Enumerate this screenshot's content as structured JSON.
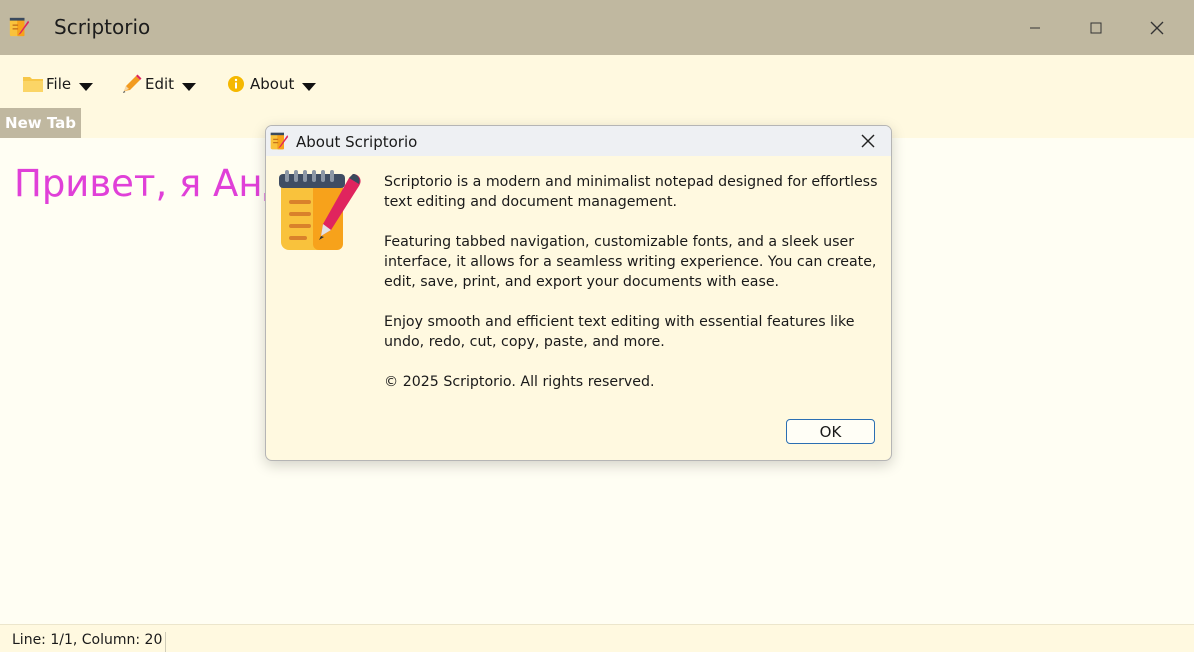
{
  "window": {
    "title": "Scriptorio",
    "controls": {
      "minimize": "minimize-icon",
      "maximize": "maximize-icon",
      "close": "close-icon"
    }
  },
  "menubar": {
    "items": [
      {
        "label": "File",
        "icon": "folder-icon"
      },
      {
        "label": "Edit",
        "icon": "pencil-icon"
      },
      {
        "label": "About",
        "icon": "info-icon"
      }
    ]
  },
  "tabs": [
    {
      "label": "New Tab",
      "active": true
    }
  ],
  "editor": {
    "content": "Привет, я Анд"
  },
  "statusbar": {
    "position": "Line: 1/1, Column: 20"
  },
  "dialog": {
    "title": "About Scriptorio",
    "paragraphs": [
      "Scriptorio is a modern and minimalist notepad designed for effortless text editing and document management.",
      "Featuring tabbed navigation, customizable fonts, and a sleek user interface, it allows for a seamless writing experience. You can create, edit, save, print, and export your documents with ease.",
      "Enjoy smooth and efficient text editing with essential features like undo, redo, cut, copy, paste, and more.",
      "© 2025 Scriptorio. All rights reserved."
    ],
    "ok_label": "OK"
  },
  "colors": {
    "titlebar": "#c0b8a0",
    "background": "#fffef3",
    "menubar": "#fff9e0",
    "editor_text": "#e040d8",
    "ok_border": "#2b6fb3"
  }
}
